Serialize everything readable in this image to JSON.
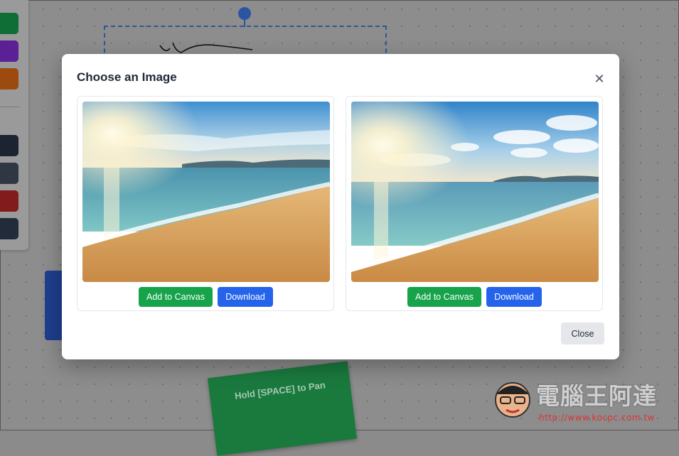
{
  "modal": {
    "title": "Choose an Image",
    "close_icon": "close-icon",
    "close_label": "Close",
    "images": [
      {
        "add_label": "Add to Canvas",
        "download_label": "Download"
      },
      {
        "add_label": "Add to Canvas",
        "download_label": "Download"
      }
    ]
  },
  "canvas": {
    "sticky_note": "Hold [SPACE] to Pan",
    "toolbar_swatches": [
      "#0f7a3a",
      "#6b21a8",
      "#b45309",
      "#1f2937",
      "#374151",
      "#991b1b",
      "#273244"
    ]
  },
  "watermark": {
    "text": "電腦王阿達",
    "url": "http://www.kocpc.com.tw"
  }
}
